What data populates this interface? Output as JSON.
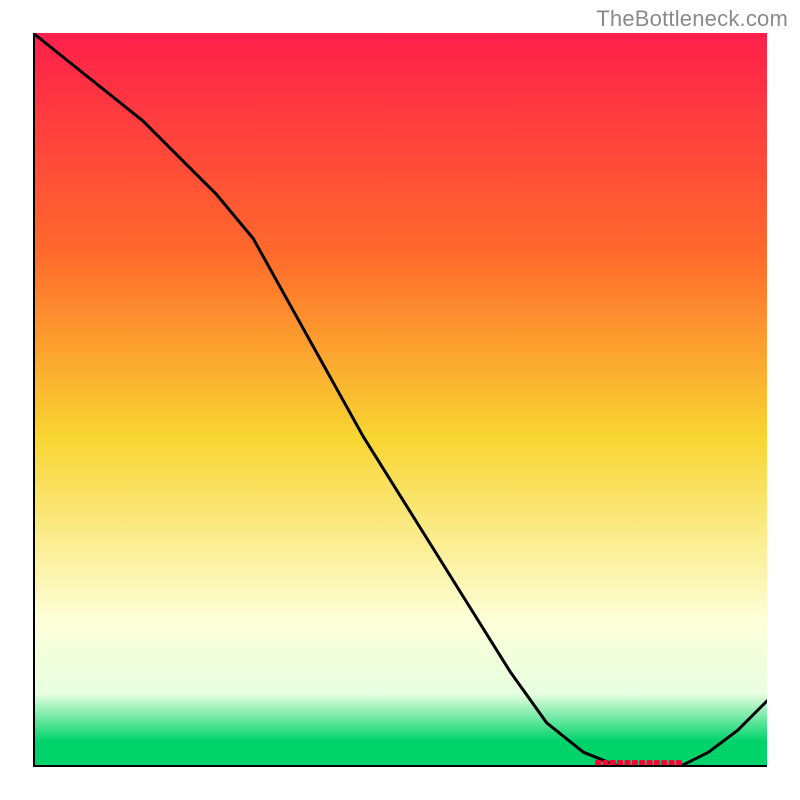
{
  "watermark": "TheBottleneck.com",
  "colors": {
    "gradient_top": "#ff1f4b",
    "gradient_mid": "#f8d531",
    "gradient_pale": "#fdffd8",
    "gradient_light": "#e7ffe0",
    "gradient_green": "#00d36a",
    "line_stroke": "#000000",
    "marker_fill": "#ff0034",
    "axis": "#000000"
  },
  "chart_data": {
    "type": "line",
    "title": "",
    "xlabel": "",
    "ylabel": "",
    "xlim": [
      0,
      100
    ],
    "ylim": [
      0,
      100
    ],
    "x": [
      0,
      5,
      10,
      15,
      20,
      25,
      30,
      35,
      40,
      45,
      50,
      55,
      60,
      65,
      70,
      75,
      80,
      85,
      88,
      92,
      96,
      100
    ],
    "values": [
      100,
      96,
      92,
      88,
      83,
      78,
      72,
      63,
      54,
      45,
      37,
      29,
      21,
      13,
      6,
      2,
      0,
      0,
      0,
      2,
      5,
      9
    ],
    "marker_range_x": [
      77,
      88
    ]
  }
}
